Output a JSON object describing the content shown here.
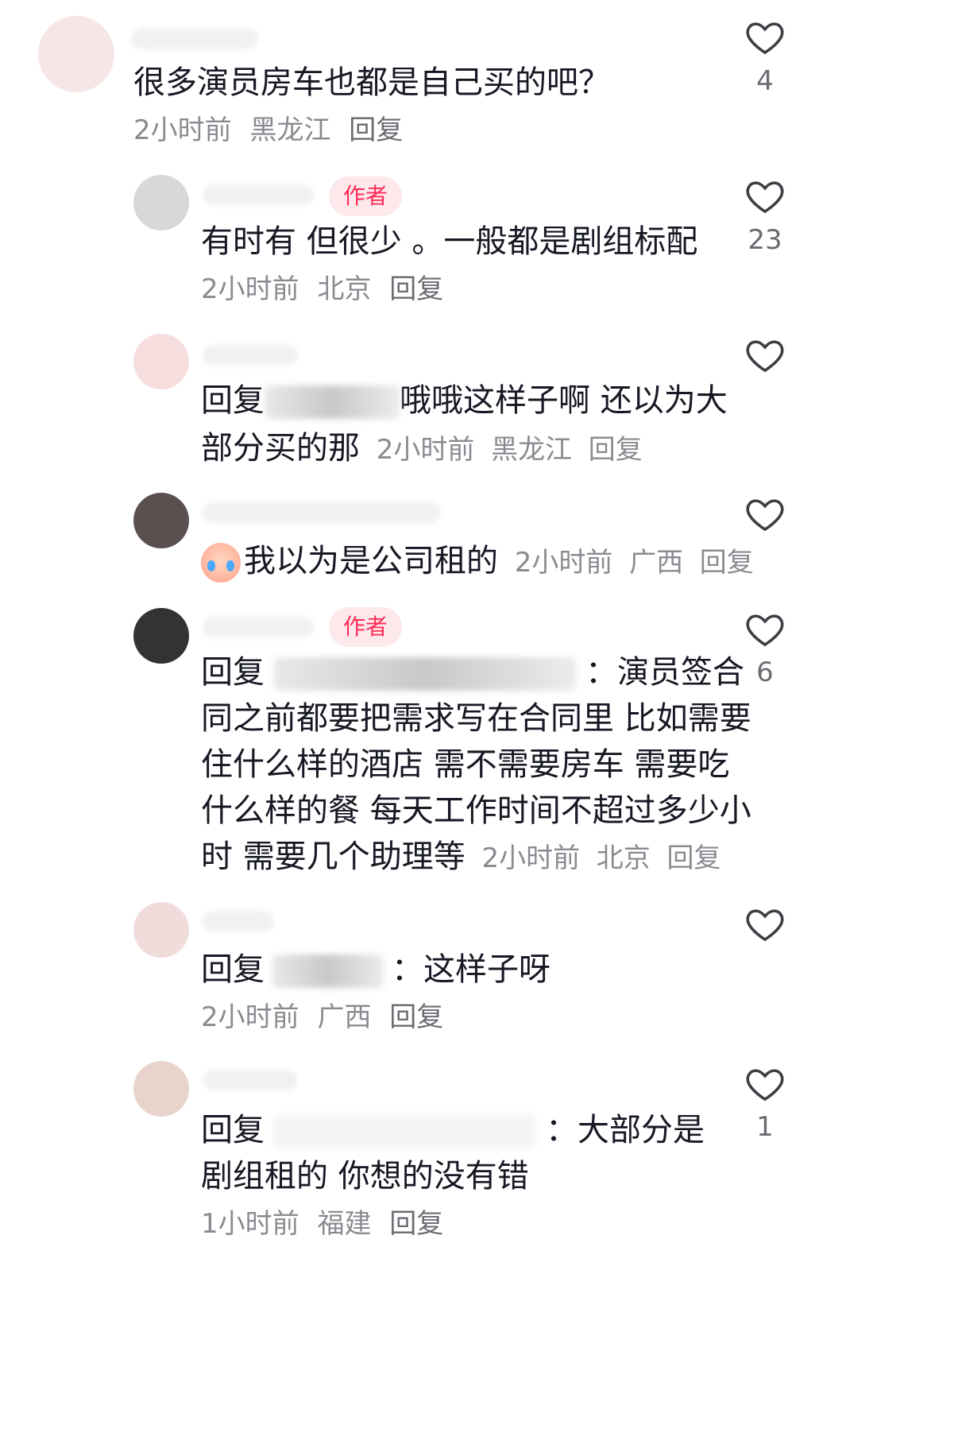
{
  "colors": {
    "text": "#161823",
    "meta": "#8a8b91",
    "accent": "#fe2c55",
    "badge_bg": "#fde8ec"
  },
  "comments": [
    {
      "text": "很多演员房车也都是自己买的吧？",
      "time": "2小时前",
      "location": "黑龙江",
      "reply": "回复",
      "likes": "4",
      "liked": false,
      "heart_icon": "heart-outline-icon"
    },
    {
      "badge": "作者",
      "text": "有时有 但很少 。一般都是剧组标配",
      "time": "2小时前",
      "location": "北京",
      "reply": "回复",
      "likes": "23",
      "heart_icon": "heart-outline-icon"
    },
    {
      "prefix": "回复",
      "text": "哦哦这样子啊 还以为大",
      "text2": "部分买的那",
      "time": "2小时前",
      "location": "黑龙江",
      "reply": "回复",
      "likes": "",
      "heart_icon": "heart-outline-icon"
    },
    {
      "emoji": "crying-face-emoji",
      "text": "我以为是公司租的",
      "time": "2小时前",
      "location": "广西",
      "reply": "回复",
      "likes": "",
      "heart_icon": "heart-outline-icon"
    },
    {
      "badge": "作者",
      "prefix": "回复",
      "text": "：演员签合",
      "lines": [
        "同之前都要把需求写在合同里 比如需要",
        "住什么样的酒店 需不需要房车 需要吃",
        "什么样的餐 每天工作时间不超过多少小"
      ],
      "last_line": "时 需要几个助理等",
      "time": "2小时前",
      "location": "北京",
      "reply": "回复",
      "likes": "6",
      "heart_icon": "heart-outline-icon"
    },
    {
      "prefix": "回复",
      "text": "：这样子呀",
      "time": "2小时前",
      "location": "广西",
      "reply": "回复",
      "likes": "",
      "heart_icon": "heart-outline-icon"
    },
    {
      "prefix": "回复",
      "text": "：大部分是",
      "text2": "剧组租的 你想的没有错",
      "time": "1小时前",
      "location": "福建",
      "reply": "回复",
      "likes": "1",
      "heart_icon": "heart-outline-icon"
    }
  ]
}
